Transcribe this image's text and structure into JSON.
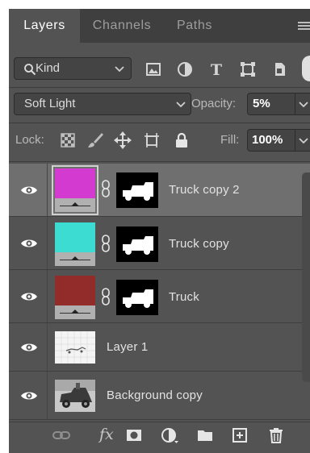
{
  "tabs": [
    {
      "label": "Layers",
      "active": true
    },
    {
      "label": "Channels",
      "active": false
    },
    {
      "label": "Paths",
      "active": false
    }
  ],
  "filter": {
    "kind_label": "Kind",
    "filter_icons": [
      "image-filter-icon",
      "adjustment-filter-icon",
      "type-filter-icon",
      "shape-filter-icon",
      "smart-object-filter-icon"
    ]
  },
  "blend": {
    "mode": "Soft Light",
    "opacity_label": "Opacity:",
    "opacity_value": "5%"
  },
  "lock": {
    "label": "Lock:",
    "icons": [
      "lock-transparent-pixels-icon",
      "lock-image-pixels-icon",
      "lock-position-icon",
      "lock-artboard-icon",
      "lock-all-icon"
    ],
    "fill_label": "Fill:",
    "fill_value": "100%"
  },
  "layers": [
    {
      "name": "Truck copy 2",
      "type": "adjustment",
      "swatch_color": "#d23ad0",
      "has_mask": true,
      "selected": true,
      "visible": true
    },
    {
      "name": "Truck copy",
      "type": "adjustment",
      "swatch_color": "#3ddcd3",
      "has_mask": true,
      "selected": false,
      "visible": true
    },
    {
      "name": "Truck",
      "type": "adjustment",
      "swatch_color": "#922c2a",
      "has_mask": true,
      "selected": false,
      "visible": true
    },
    {
      "name": "Layer 1",
      "type": "pixel",
      "selected": false,
      "visible": true
    },
    {
      "name": "Background copy",
      "type": "photo",
      "selected": false,
      "visible": true
    }
  ],
  "footer_icons": [
    "link-layers-icon",
    "fx-icon",
    "add-mask-icon",
    "new-adjustment-icon",
    "new-group-icon",
    "new-layer-icon",
    "delete-layer-icon"
  ],
  "footer": {
    "fx_label": "fx"
  },
  "colors": {
    "panel_bg": "#535353",
    "tabbar_bg": "#3f3f3f",
    "selected_row": "#6f6f6f"
  }
}
